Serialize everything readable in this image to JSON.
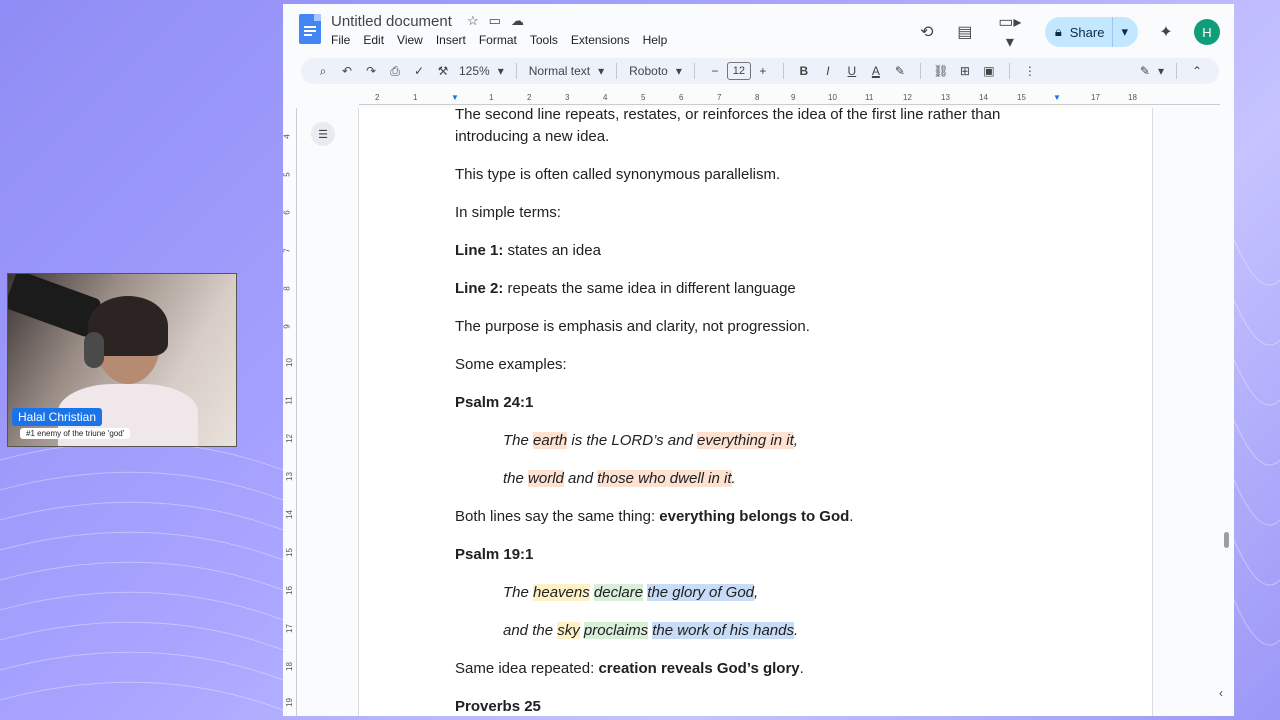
{
  "window": {
    "doc_title": "Untitled document",
    "menu": [
      "File",
      "Edit",
      "View",
      "Insert",
      "Format",
      "Tools",
      "Extensions",
      "Help"
    ],
    "share_label": "Share",
    "avatar_initial": "H"
  },
  "toolbar": {
    "zoom": "125%",
    "style": "Normal text",
    "font": "Roboto",
    "font_size": "12",
    "minus": "−",
    "plus": "+",
    "bold": "B",
    "italic": "I",
    "underline": "U",
    "text_color": "A",
    "more": "⋮"
  },
  "ruler": {
    "h_ticks": [
      "2",
      "1",
      "1",
      "1",
      "2",
      "3",
      "4",
      "5",
      "6",
      "7",
      "8",
      "9",
      "10",
      "11",
      "12",
      "13",
      "14",
      "15",
      "16",
      "17",
      "18"
    ],
    "v_ticks": [
      "4",
      "5",
      "6",
      "7",
      "8",
      "9",
      "10",
      "11",
      "12",
      "13",
      "14",
      "15",
      "16",
      "17",
      "18",
      "19"
    ]
  },
  "webcam": {
    "name": "Halal Christian",
    "subtitle": "#1 enemy of the triune 'god'"
  },
  "document": {
    "p1a": "The second line repeats, restates, or reinforces the idea of the first line rather than",
    "p1b": "introducing a new idea.",
    "p2": "This type is often called synonymous parallelism.",
    "p3": "In simple terms:",
    "line1_label": "Line 1:",
    "line1_text": " states an idea",
    "line2_label": "Line 2:",
    "line2_text": " repeats the same idea in different language",
    "p4": "The purpose is emphasis and clarity, not progression.",
    "p5": "Some examples:",
    "ps24_heading": "Psalm 24:1",
    "ps24_l1": [
      "The ",
      "earth",
      " is the LORD’s and ",
      "everything in it",
      ","
    ],
    "ps24_l2": [
      "the ",
      "world",
      " and ",
      "those who dwell in it",
      "."
    ],
    "both_prefix": "Both lines say the same thing: ",
    "both_bold": "everything belongs to God",
    "both_suffix": ".",
    "ps19_heading": "Psalm 19:1",
    "ps19_l1": [
      "The ",
      "heavens",
      " ",
      "declare",
      " ",
      "the glory of God",
      ","
    ],
    "ps19_l2": [
      "and the ",
      "sky",
      " ",
      "proclaims",
      " ",
      "the work of his hands",
      "."
    ],
    "same_prefix": "Same idea repeated: ",
    "same_bold": "creation reveals God’s glory",
    "same_suffix": ".",
    "prov_heading": "Proverbs 25"
  },
  "colors": {
    "highlight_orange": "#fde2d2",
    "highlight_yellow": "#fff1c6",
    "highlight_green": "#d9efd9",
    "highlight_blue": "#c9dcf5",
    "share_bg": "#c2e7ff",
    "avatar_bg": "#0f9d7a"
  }
}
